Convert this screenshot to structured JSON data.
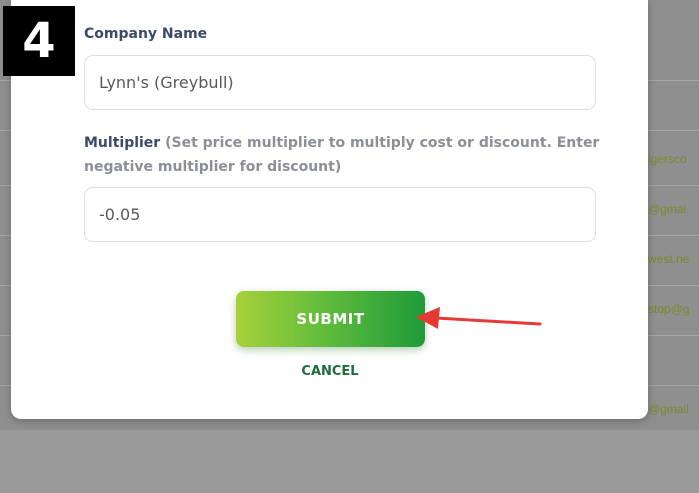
{
  "step": {
    "number": "4"
  },
  "form": {
    "company_name": {
      "label": "Company Name",
      "value": "Lynn's (Greybull)"
    },
    "multiplier": {
      "label": "Multiplier",
      "hint": "(Set price multiplier to multiply cost or discount. Enter negative multiplier for discount)",
      "value": "-0.05"
    },
    "submit_label": "SUBMIT",
    "cancel_label": "CANCEL"
  },
  "background": {
    "emails": [
      "lgersco",
      "@gmai",
      "west.ne",
      "stop@g",
      "@gmail"
    ]
  },
  "colors": {
    "label": "#3b4a6b",
    "hint": "#8a8f98",
    "submit_gradient_start": "#a8d13a",
    "submit_gradient_end": "#1f9a3a",
    "cancel": "#1e6b3c",
    "arrow": "#e53935",
    "badge_bg": "#000000"
  }
}
